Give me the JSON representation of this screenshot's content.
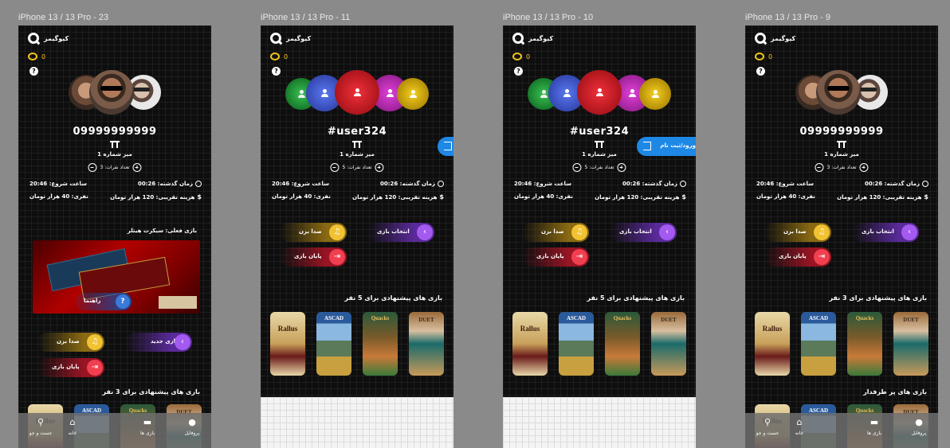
{
  "frames": [
    {
      "title": "iPhone 13 / 13 Pro - 23",
      "username": "09999999999",
      "table_label": "میز شماره 1",
      "count_label": "تعداد نفرات: 3",
      "time_elapsed": "زمان گذشته: 00:26",
      "start_time": "ساعت شروع: 20:46",
      "cost": "هزینه تقریبی: 120 هزار تومان",
      "per_person": "نفری: 40 هزار تومان",
      "current_game_label": "بازی فعلی:   سیکرت هیتلر",
      "guide_label": "راهنما",
      "btn_new_game": "بازی جدید",
      "btn_call": "صدا بزن",
      "btn_end": "پایان بازی",
      "suggest_title": "بازی های پیشنهادی برای 3 نفر"
    },
    {
      "title": "iPhone 13 / 13 Pro - 11",
      "username": "#user324",
      "table_label": "میز شماره 1",
      "count_label": "تعداد نفرات: 5",
      "time_elapsed": "زمان گذشته: 00:26",
      "start_time": "ساعت شروع: 20:46",
      "cost": "هزینه تقریبی: 120 هزار تومان",
      "per_person": "نفری: 40 هزار تومان",
      "btn_choose": "انتخاب بازی",
      "btn_call": "صدا بزن",
      "btn_end": "پایان بازی",
      "suggest_title": "بازی های پیشنهادی برای 5 نفر"
    },
    {
      "title": "iPhone 13 / 13 Pro - 10",
      "username": "#user324",
      "table_label": "میز شماره 1",
      "count_label": "تعداد نفرات: 5",
      "time_elapsed": "زمان گذشته: 00:26",
      "start_time": "ساعت شروع: 20:46",
      "cost": "هزینه تقریبی: 120 هزار تومان",
      "per_person": "نفری: 40 هزار تومان",
      "login_label": "ورود/ثبت نام",
      "btn_choose": "انتخاب بازی",
      "btn_call": "صدا بزن",
      "btn_end": "پایان بازی",
      "suggest_title": "بازی های پیشنهادی برای 5 نفر"
    },
    {
      "title": "iPhone 13 / 13 Pro - 9",
      "username": "09999999999",
      "table_label": "میز شماره 1",
      "count_label": "تعداد نفرات: 3",
      "time_elapsed": "زمان گذشته: 00:26",
      "start_time": "ساعت شروع: 20:46",
      "cost": "هزینه تقریبی: 120 هزار تومان",
      "per_person": "نفری: 40 هزار تومان",
      "btn_choose": "انتخاب بازی",
      "btn_call": "صدا بزن",
      "btn_end": "پایان بازی",
      "suggest_title": "بازی های پیشنهادی برای 3 نفر",
      "popular_title": "بازی های پر طرفدار"
    }
  ],
  "app": {
    "name": "کیوگیمز",
    "coins": "0",
    "help": "?"
  },
  "cards": [
    "Rallus",
    "ASCAD",
    "Quacks",
    "DUET"
  ],
  "nav": {
    "profile": "پروفایل",
    "games": "بازی ها",
    "home": "خانه",
    "search": "جست و جو"
  },
  "colors": {
    "yellow": "#f1c232",
    "purple": "#a45af0",
    "red": "#f04050",
    "blue": "#1e88e5"
  }
}
